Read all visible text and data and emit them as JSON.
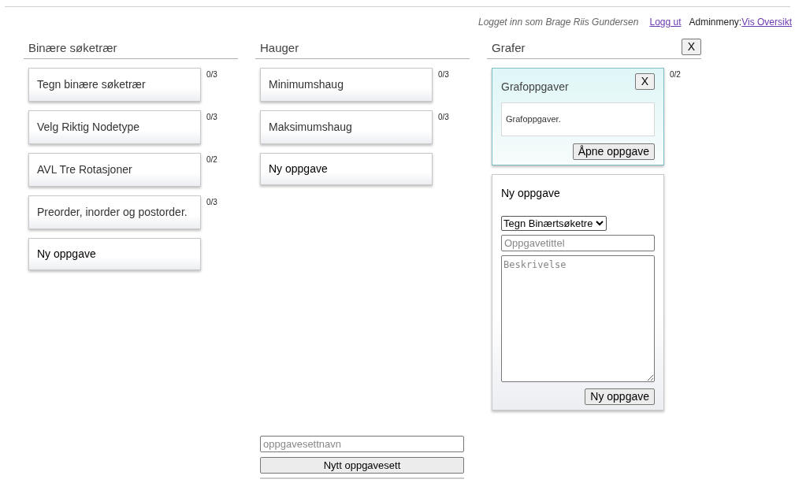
{
  "header": {
    "user_text": "Logget inn som Brage Riis Gundersen",
    "logout_link": "Logg ut",
    "admin_label": "Adminmeny:",
    "admin_link": "Vis Oversikt"
  },
  "columns": [
    {
      "title": "Binære søketrær",
      "items": [
        {
          "kind": "task",
          "title": "Tegn binære søketrær",
          "score": "0/3"
        },
        {
          "kind": "task",
          "title": "Velg Riktig Nodetype",
          "score": "0/3"
        },
        {
          "kind": "task",
          "title": "AVL Tre Rotasjoner",
          "score": "0/2"
        },
        {
          "kind": "task",
          "title": "Preorder, inorder og postorder.",
          "score": "0/3"
        },
        {
          "kind": "add",
          "label": "Ny oppgave"
        }
      ]
    },
    {
      "title": "Hauger",
      "items": [
        {
          "kind": "task",
          "title": "Minimumshaug",
          "score": "0/3"
        },
        {
          "kind": "task",
          "title": "Maksimumshaug",
          "score": "0/3"
        },
        {
          "kind": "add",
          "label": "Ny oppgave"
        }
      ]
    },
    {
      "title": "Grafer",
      "close_button": "X",
      "items": [
        {
          "kind": "expanded",
          "title": "Grafoppgaver",
          "score": "0/2",
          "close_button": "X",
          "description": "Grafoppgaver.",
          "open_button": "Åpne oppgave"
        },
        {
          "kind": "form",
          "heading": "Ny oppgave",
          "select_value": "Tegn Binærtsøketre",
          "title_placeholder": "Oppgavetittel",
          "description_placeholder": "Beskrivelse",
          "submit_button": "Ny oppgave"
        }
      ]
    }
  ],
  "footer": {
    "name_placeholder": "oppgavesettnavn",
    "create_button": "Nytt oppgavesett"
  }
}
